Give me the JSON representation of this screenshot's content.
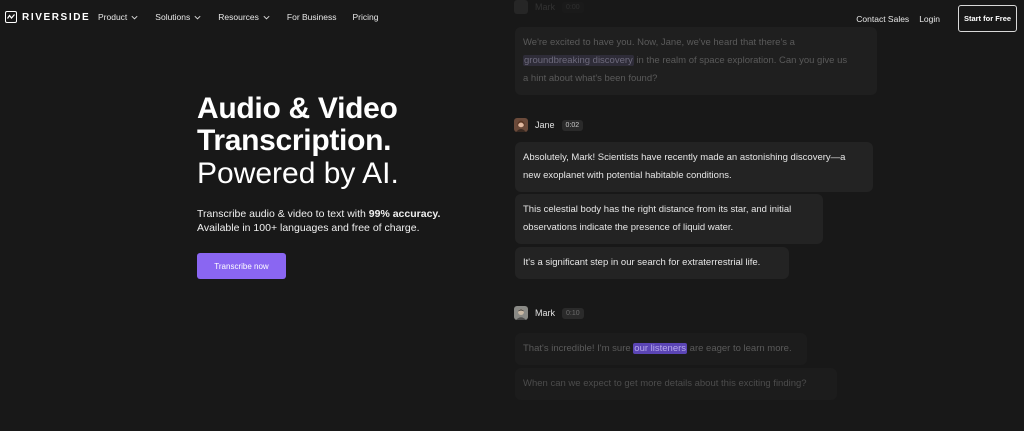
{
  "nav": {
    "brand": "RIVERSIDE",
    "links": [
      {
        "label": "Product",
        "dropdown": true
      },
      {
        "label": "Solutions",
        "dropdown": true
      },
      {
        "label": "Resources",
        "dropdown": true
      },
      {
        "label": "For Business",
        "dropdown": false
      },
      {
        "label": "Pricing",
        "dropdown": false
      }
    ],
    "contact_sales": "Contact Sales",
    "login": "Login",
    "cta": "Start for Free"
  },
  "hero": {
    "title_line1": "Audio & Video",
    "title_line2": "Transcription.",
    "title_line3": "Powered by AI.",
    "sub_prefix": "Transcribe audio & video to text with ",
    "sub_bold": "99% accuracy.",
    "sub_line2": "Available in 100+ languages and free of charge.",
    "button": "Transcribe now"
  },
  "transcript": {
    "top_faded_speaker": "Mark",
    "top_faded_time": "0:00",
    "top_bubble_pre": "We're excited to have you. Now, Jane, we've heard that there's a",
    "top_bubble_highlight": "groundbreaking discovery",
    "top_bubble_post": " in the realm of space exploration. Can you give us",
    "top_bubble_line3": "a hint about what's been found?",
    "jane_name": "Jane",
    "jane_time": "0:02",
    "jane_1_line1": "Absolutely, Mark! Scientists have recently made an astonishing discovery—a",
    "jane_1_line2": "new exoplanet with potential habitable conditions.",
    "jane_2_line1": " This celestial body has the right distance from its star, and initial",
    "jane_2_line2": "observations indicate the presence of liquid water.",
    "jane_3": "It's a significant step in our search for extraterrestrial life.",
    "mark_name": "Mark",
    "mark_time": "0:10",
    "mark_1_pre": "That's incredible! I'm sure ",
    "mark_1_highlight": "our listeners",
    "mark_1_post": " are eager to learn more.",
    "mark_2": "When can we expect to get more details about this exciting finding?"
  },
  "colors": {
    "background": "#181818",
    "accent": "#8a66f2",
    "highlight": "#5b45b5"
  }
}
